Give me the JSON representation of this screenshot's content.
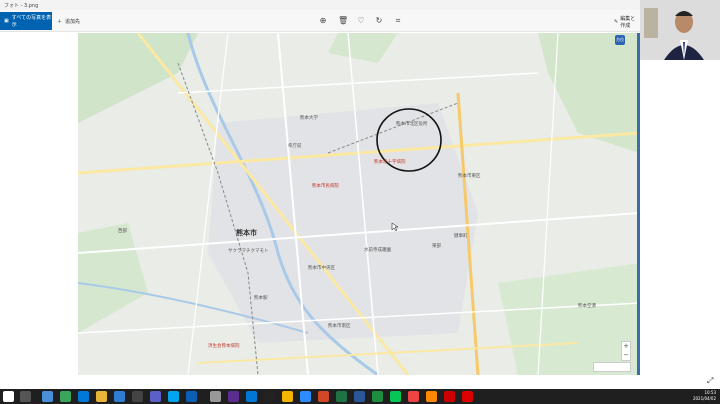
{
  "window": {
    "title": "フォト - 3.png"
  },
  "toolbar": {
    "back_label": "すべての写真を表示",
    "add_label": "追加先",
    "edit_label": "編集と作成",
    "icons": [
      "zoom-icon",
      "delete-icon",
      "favorite-icon",
      "rotate-icon",
      "crop-icon"
    ]
  },
  "map": {
    "city_label": "熊本市",
    "labels": [
      {
        "text": "熊本市北区役所",
        "tone": "normal"
      },
      {
        "text": "熊本大学",
        "tone": "normal"
      },
      {
        "text": "熊本赤十字病院",
        "tone": "red"
      },
      {
        "text": "熊本市民病院",
        "tone": "red"
      },
      {
        "text": "熊本市東区",
        "tone": "normal"
      },
      {
        "text": "熊本駅",
        "tone": "normal"
      },
      {
        "text": "健軍町",
        "tone": "normal"
      },
      {
        "text": "水前寺成趣園",
        "tone": "normal"
      },
      {
        "text": "熊本市中央区",
        "tone": "normal"
      },
      {
        "text": "熊本市南区",
        "tone": "normal"
      },
      {
        "text": "県庁前",
        "tone": "normal"
      },
      {
        "text": "西部",
        "tone": "normal"
      },
      {
        "text": "東部",
        "tone": "normal"
      },
      {
        "text": "サクラマチクマモト",
        "tone": "normal"
      },
      {
        "text": "済生会熊本病院",
        "tone": "red"
      },
      {
        "text": "熊本空港",
        "tone": "normal"
      }
    ],
    "compass_label": "方位"
  },
  "taskbar": {
    "time": "10:53",
    "date": "2021/04/02"
  }
}
